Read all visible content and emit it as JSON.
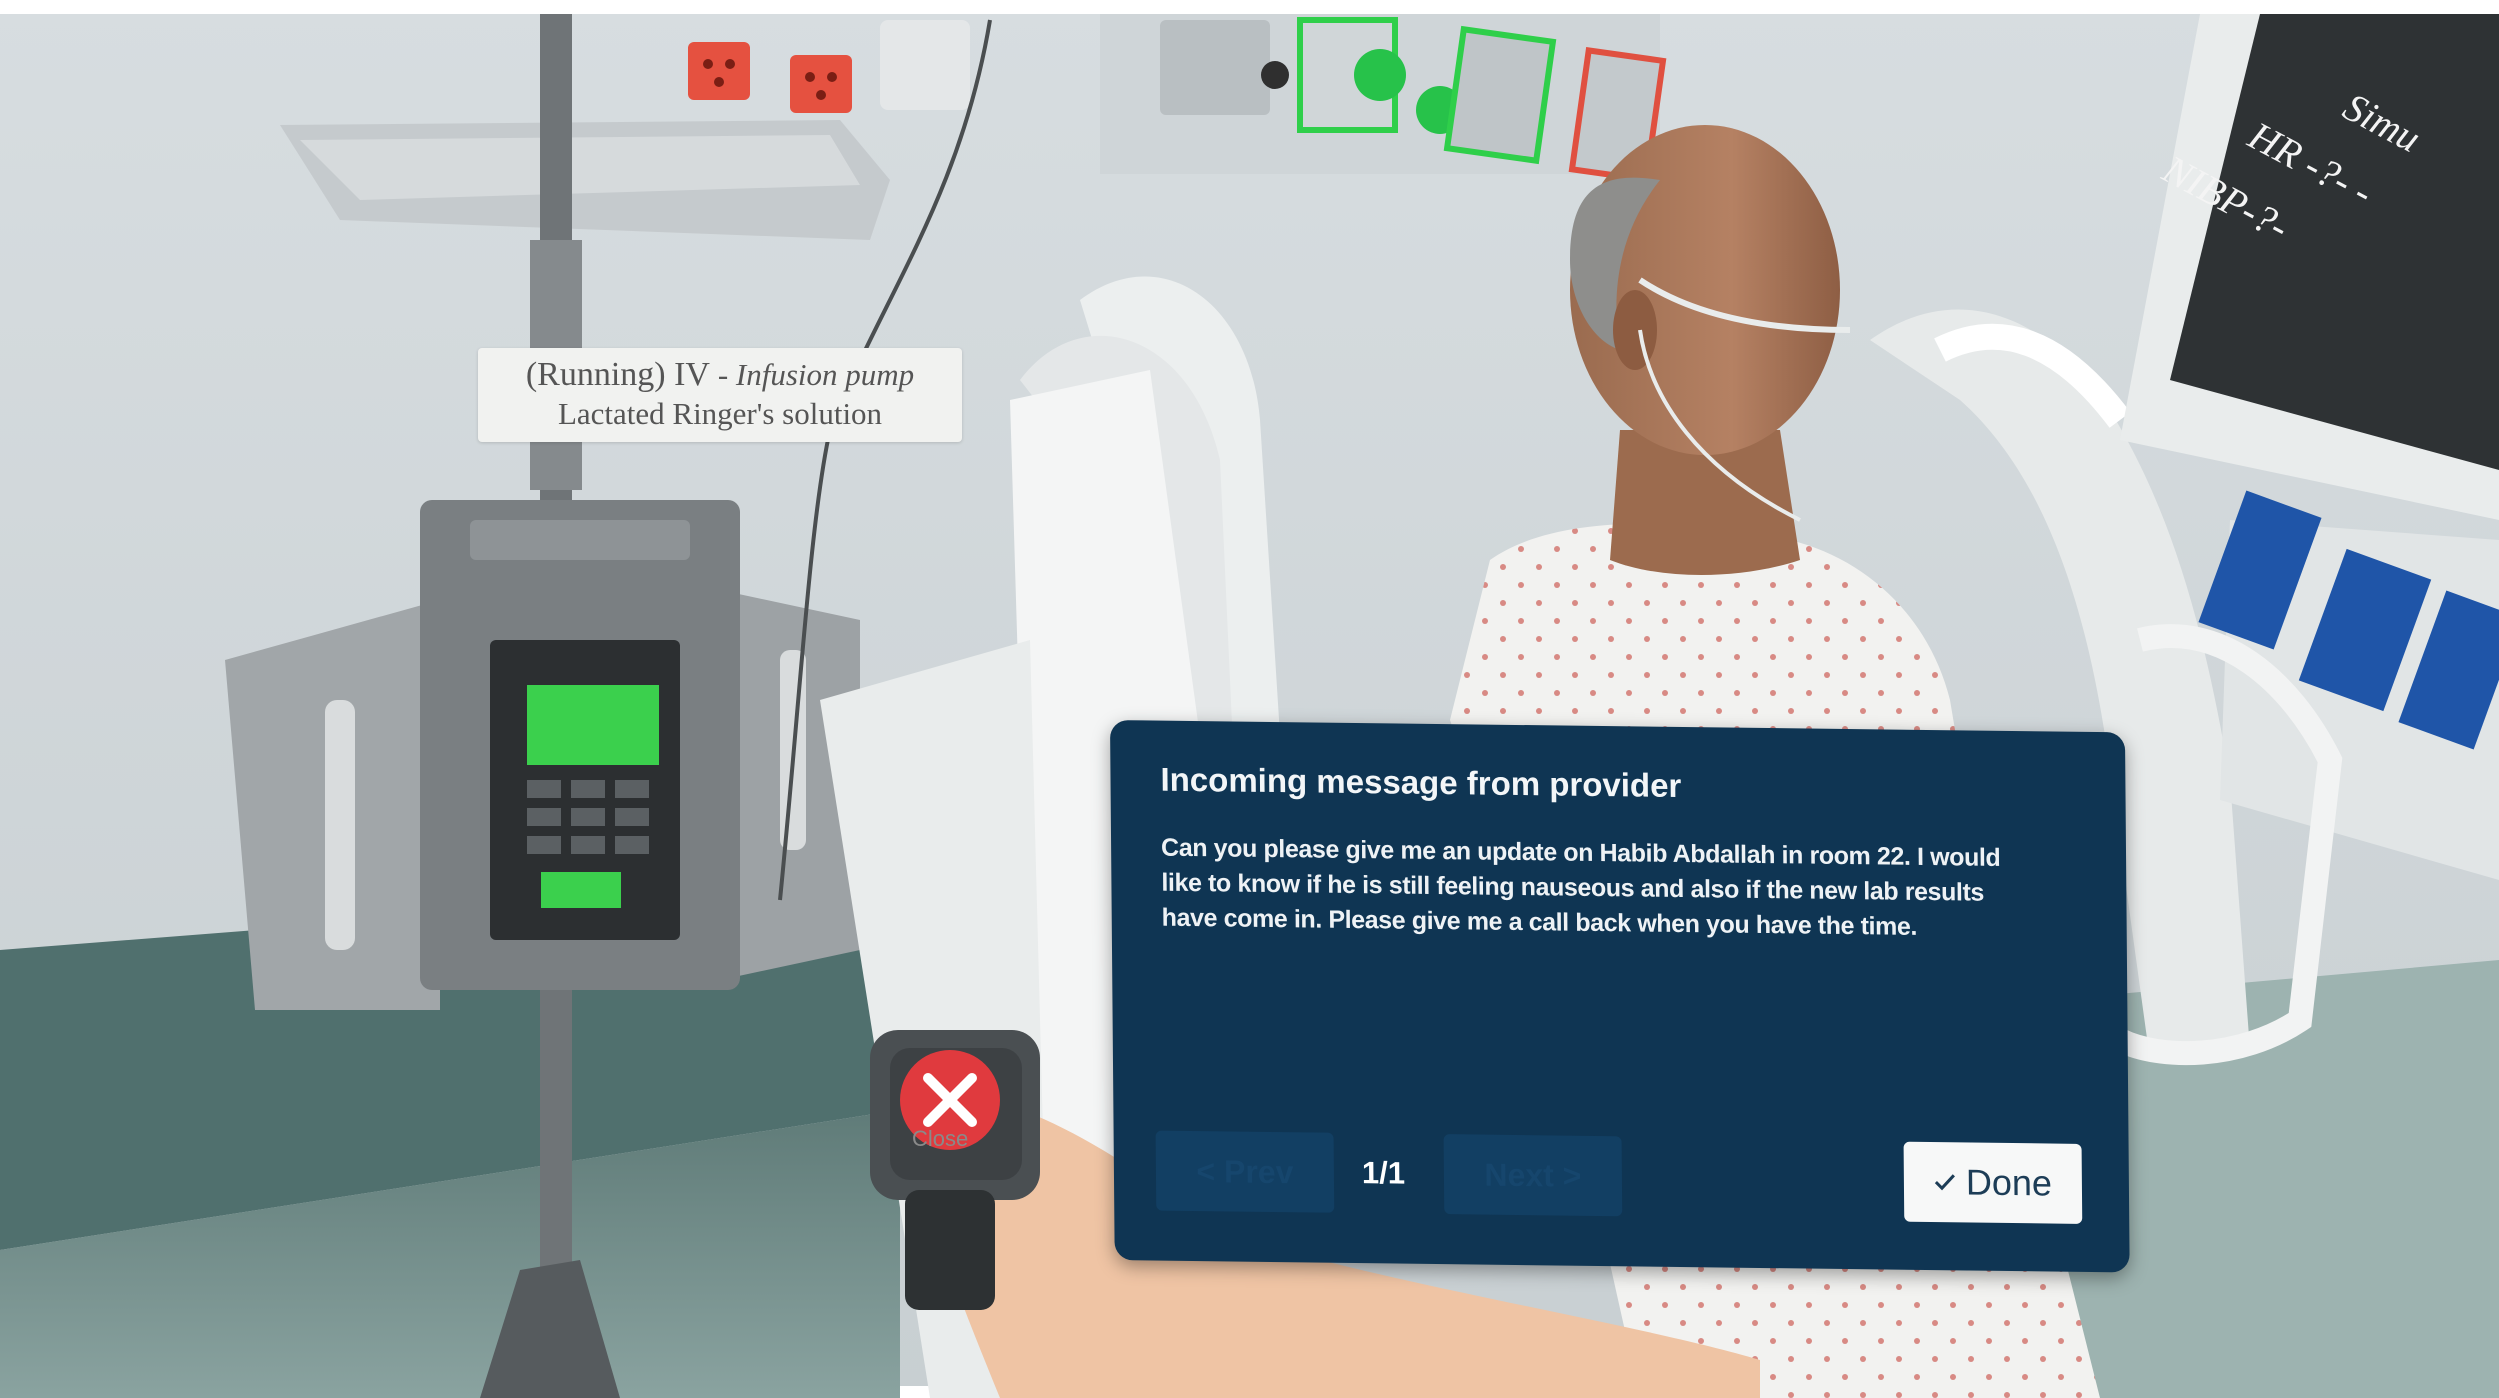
{
  "iv_label": {
    "status": "(Running)",
    "device": "IV",
    "device_type": "- Infusion pump",
    "solution": "Lactated Ringer's solution"
  },
  "monitor": {
    "lines": [
      "Simu",
      "HR -?- -",
      "NIBP-?-"
    ]
  },
  "message": {
    "title": "Incoming message from provider",
    "body_lines": [
      "Can you please give me an update on Habib Abdallah in room 22. I would",
      "like to know if he is still feeling nauseous and also if the new lab results",
      "have come in. Please give me a call back when you have the time."
    ],
    "prev_label": "< Prev",
    "next_label": "Next >",
    "page_indicator": "1/1",
    "done_label": "Done",
    "done_icon": "checkmark-icon"
  },
  "watch": {
    "close_label": "Close",
    "close_icon": "close-x-icon",
    "close_color": "#e03a3e"
  },
  "colors": {
    "panel": "#0f3553",
    "nav_disabled": "#123f63",
    "done_bg": "#f7f8f8"
  }
}
